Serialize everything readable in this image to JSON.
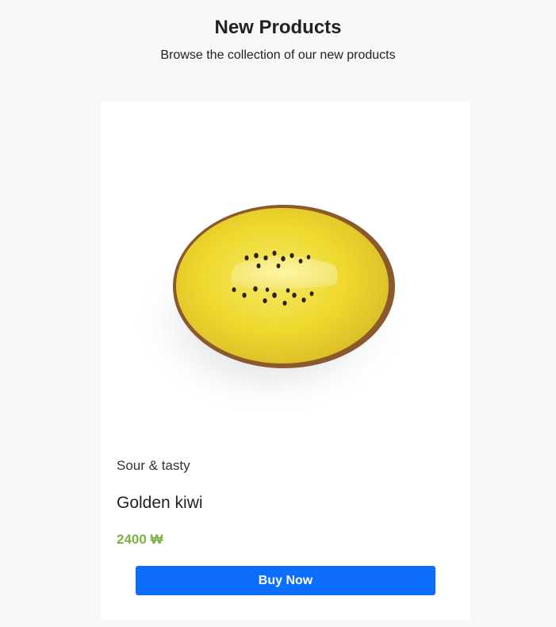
{
  "header": {
    "title": "New Products",
    "subtitle": "Browse the collection of our new products"
  },
  "product": {
    "image_alt": "golden-kiwi-image",
    "tagline": "Sour & tasty",
    "name": "Golden kiwi",
    "price": "2400 ₩",
    "buy_label": "Buy Now"
  },
  "colors": {
    "accent": "#0d6efd",
    "price": "#7cb342",
    "background": "#f8f8f8",
    "card": "#ffffff"
  }
}
